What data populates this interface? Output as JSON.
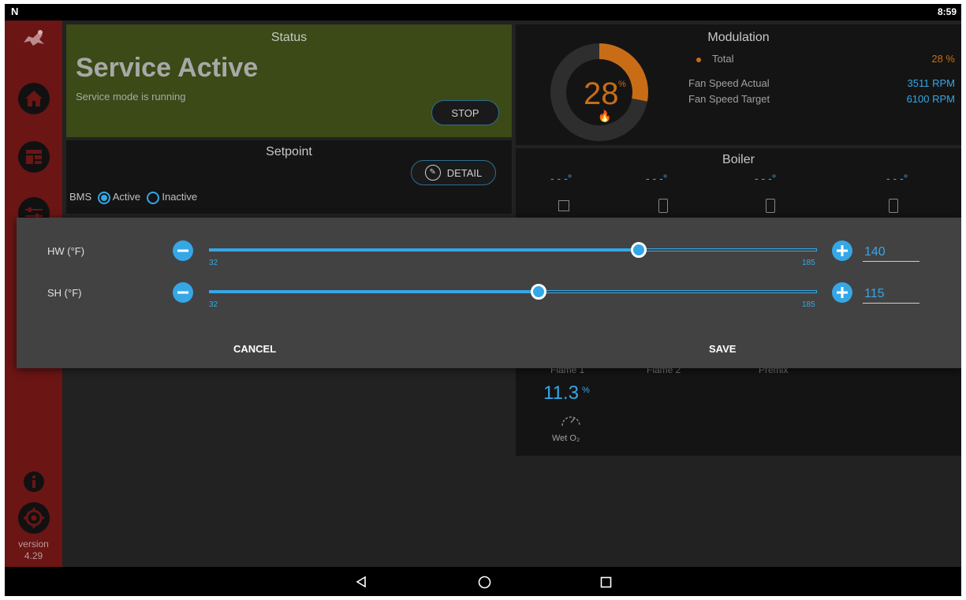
{
  "statusbar": {
    "clock": "8:59",
    "notification_icon": "n-logo-icon"
  },
  "sidebar": {
    "items": [
      {
        "icon": "logo-icon"
      },
      {
        "icon": "home-icon"
      },
      {
        "icon": "dashboard-icon"
      },
      {
        "icon": "sliders-icon"
      },
      {
        "icon": "info-icon"
      },
      {
        "icon": "gear-icon"
      }
    ],
    "version_label": "version",
    "version_number": "4.29"
  },
  "status_panel": {
    "title": "Status",
    "headline": "Service Active",
    "subtext": "Service mode is running",
    "stop_label": "STOP",
    "background": "#3b4a16"
  },
  "setpoint_panel": {
    "title": "Setpoint",
    "detail_label": "DETAIL",
    "bms_label": "BMS",
    "active_label": "Active",
    "inactive_label": "Inactive",
    "bms_selected": "Active"
  },
  "modulation_panel": {
    "title": "Modulation",
    "gauge_value": "28",
    "gauge_unit": "%",
    "gauge_fraction": 0.28,
    "total_label": "Total",
    "total_value": "28 %",
    "fan_actual_label": "Fan Speed Actual",
    "fan_actual_value": "3511 RPM",
    "fan_target_label": "Fan Speed Target",
    "fan_target_value": "6100 RPM",
    "accent": "#c86d16"
  },
  "boiler_panel": {
    "title": "Boiler",
    "temps": [
      "- - -°",
      "- - -°",
      "- - -°",
      "- - -°"
    ],
    "flame_labels": [
      "Flame 1",
      "Flame 2",
      "Premix"
    ],
    "o2_value": "11.3",
    "o2_unit": "%",
    "o2_label": "Wet O₂"
  },
  "dialog": {
    "rows": [
      {
        "label": "HW (°F)",
        "min": "32",
        "max": "185",
        "value": "140",
        "fraction": 0.7065
      },
      {
        "label": "SH (°F)",
        "min": "32",
        "max": "185",
        "value": "115",
        "fraction": 0.5425
      }
    ],
    "cancel_label": "CANCEL",
    "save_label": "SAVE",
    "accent": "#35a7e6"
  },
  "navbar": {
    "icons": [
      "back-icon",
      "home-circle-icon",
      "recents-icon"
    ]
  }
}
